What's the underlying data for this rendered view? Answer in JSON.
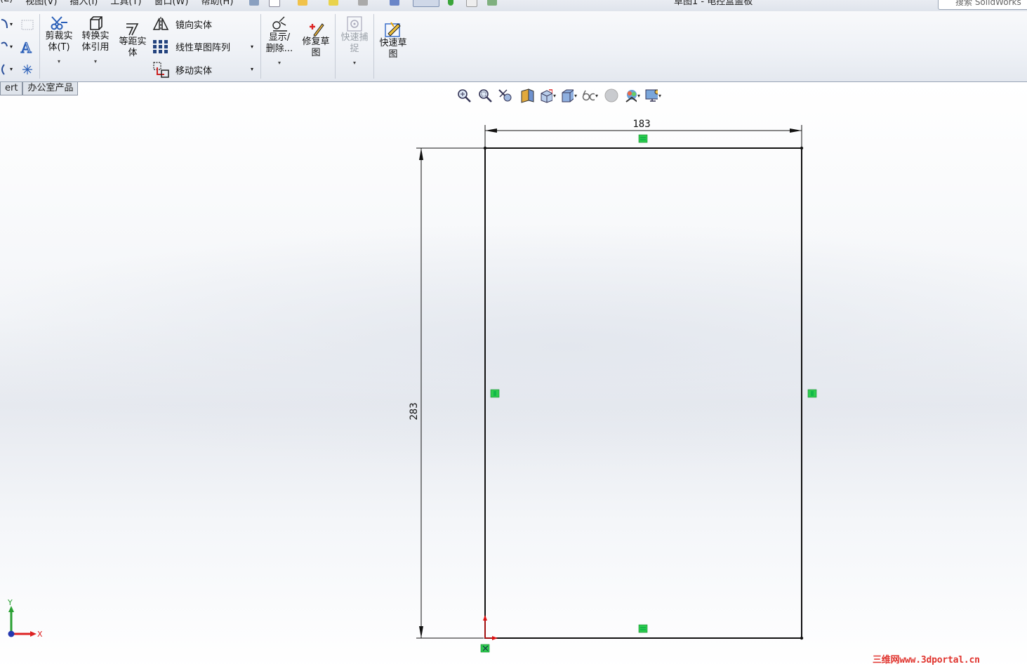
{
  "menubar": {
    "menus": [
      "(E)",
      "视图(V)",
      "插入(I)",
      "工具(T)",
      "窗口(W)",
      "帮助(H)"
    ],
    "doc_title": "草图1 - 电控盒盖板",
    "search_placeholder": "搜索 SolidWorks"
  },
  "ribbon": {
    "trim": "剪裁实\n体(T)",
    "convert": "转换实\n体引用",
    "offset": "等距实\n体",
    "mirror": "镜向实体",
    "linear_pattern": "线性草图阵列",
    "move": "移动实体",
    "display_delete": "显示/\n删除...",
    "repair": "修复草\n图",
    "quick_snap": "快速捕\n捉",
    "rapid_sketch": "快速草\n图"
  },
  "tabs": [
    "ert",
    "办公室产品"
  ],
  "sketch": {
    "width_dim": "183",
    "height_dim": "283",
    "axis_x": "X",
    "axis_y": "Y"
  },
  "watermark": "三维网www.3dportal.cn"
}
